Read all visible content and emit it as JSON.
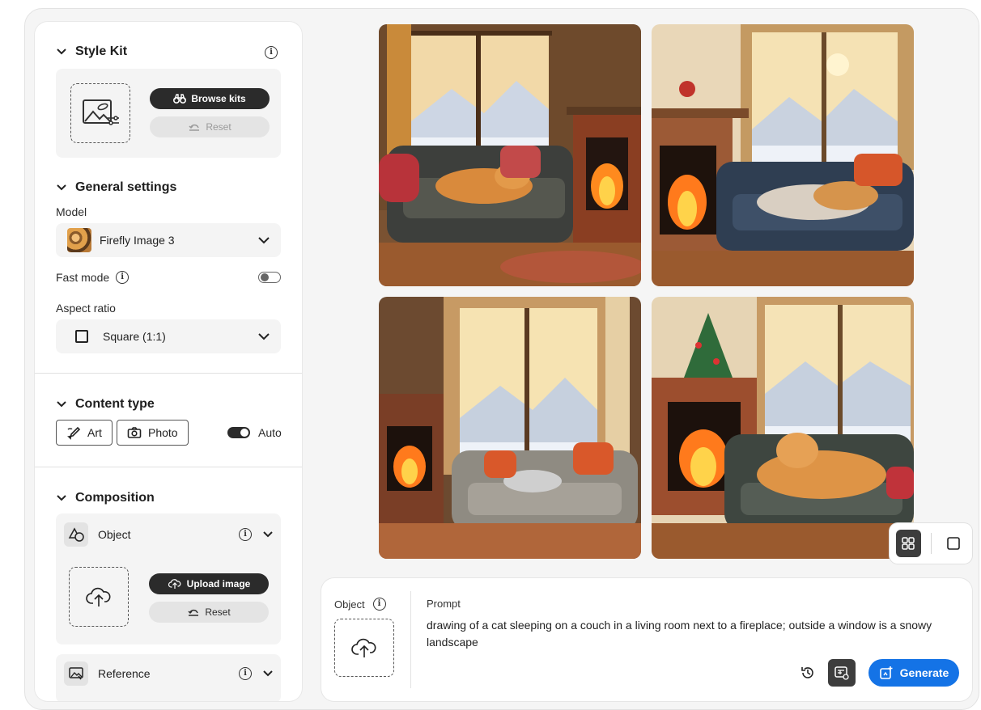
{
  "sidebar": {
    "style_kit": {
      "title": "Style Kit",
      "browse_label": "Browse kits",
      "reset_label": "Reset"
    },
    "general": {
      "title": "General settings",
      "model_label": "Model",
      "model_value": "Firefly Image 3",
      "fast_mode_label": "Fast mode",
      "fast_mode_on": false,
      "aspect_label": "Aspect ratio",
      "aspect_value": "Square (1:1)"
    },
    "content_type": {
      "title": "Content type",
      "art_label": "Art",
      "photo_label": "Photo",
      "auto_label": "Auto",
      "auto_on": true
    },
    "composition": {
      "title": "Composition",
      "object_label": "Object",
      "upload_label": "Upload image",
      "reset_label": "Reset",
      "reference_label": "Reference"
    }
  },
  "gallery": {
    "images": [
      {
        "alt": "Cat sleeping on couch by fireplace, variant 1"
      },
      {
        "alt": "Cat sleeping on couch by fireplace, variant 2"
      },
      {
        "alt": "Cat sleeping on couch by fireplace, variant 3"
      },
      {
        "alt": "Cat sleeping on couch by fireplace, variant 4"
      }
    ]
  },
  "prompt_panel": {
    "object_label": "Object",
    "prompt_label": "Prompt",
    "prompt_text": "drawing of a cat sleeping on a couch in a living room next to a fireplace; outside a window is a snowy landscape",
    "generate_label": "Generate"
  },
  "colors": {
    "accent": "#1473e6",
    "dark_button": "#2b2b2b"
  },
  "icons": {
    "style_kit": "image-settings-icon",
    "browse": "binoculars-icon",
    "reset": "undo-icon",
    "upload": "cloud-upload-icon",
    "history": "history-icon",
    "grid_view": "grid-icon",
    "single_view": "square-icon"
  }
}
